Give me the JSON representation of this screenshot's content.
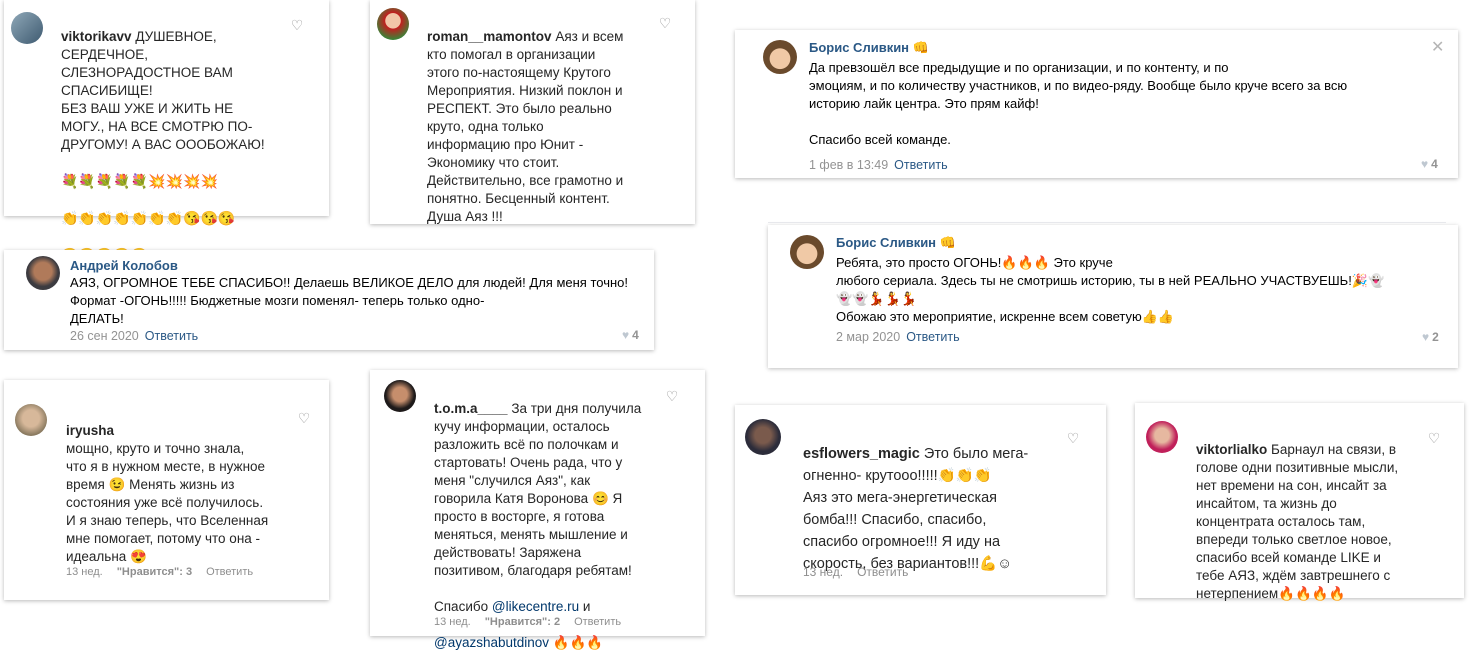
{
  "comments": {
    "c1": {
      "user": "viktorikavv",
      "text": "ДУШЕВНОЕ,\nСЕРДЕЧНОЕ,\nСЛЕЗНОРАДОСТНОЕ ВАМ\nСПАСИБИЩЕ!\nБЕЗ ВАШ УЖЕ И ЖИТЬ НЕ\nМОГУ., НА ВСЕ СМОТРЮ ПО-\nДРУГОМУ! А ВАС ОООБОЖАЮ!",
      "emoji1": "💐💐💐💐💐💥💥💥💥",
      "emoji2": "👏👏👏👏👏👏👏😘😘😘",
      "emoji3": "😘😘😘😘😘"
    },
    "c2": {
      "user": "roman__mamontov",
      "text_first": "Аяз и всем",
      "text": "кто помогал в организации\nэтого по-настоящему Крутого\nМероприятия. Низкий поклон и\nРЕСПЕКТ. Это было реально\nкруто, одна только\nинформацию про Юнит -\nЭкономику что стоит.\nДействительно, все грамотно и\nпонятно. Бесценный контент.\nДуша Аяз !!!"
    },
    "c3": {
      "user": "Борис Сливкин",
      "text": "Да  превзошёл все предыдущие и по организации, и по контенту, и по\nэмоциям, и по количеству участников, и по видео-ряду. Вообще было круче всего за всю\nисторию лайк центра. Это прям кайф!\n\nСпасибо всей команде.",
      "date": "1 фев в 13:49",
      "reply": "Ответить",
      "likes": "4",
      "close": "✕"
    },
    "c4": {
      "user": "Андрей Колобов",
      "text": "АЯЗ, ОГРОМНОЕ ТЕБЕ СПАСИБО!! Делаешь ВЕЛИКОЕ ДЕЛО для людей! Для меня точно!\nФормат -ОГОНЬ!!!!! Бюджетные мозги поменял- теперь только одно-\nДЕЛАТЬ!",
      "date": "26 сен 2020",
      "reply": "Ответить",
      "likes": "4"
    },
    "c5": {
      "user": "Борис Сливкин",
      "line1": "Ребята, это просто ОГОНЬ!🔥🔥🔥 Это круче",
      "line2": "любого сериала. Здесь ты не смотришь историю, ты в ней РЕАЛЬНО УЧАСТВУЕШЬ!🎉👻",
      "line3": "👻👻💃💃💃",
      "line4": "Обожаю это мероприятие, искренне всем советую👍👍",
      "date": "2 мар 2020",
      "reply": "Ответить",
      "likes": "2"
    },
    "c6": {
      "user": "iryusha",
      "text": "мощно, круто и точно знала,\nчто я в нужном месте, в нужное\nвремя 😉 Менять жизнь из\nсостояния уже всё получилось.\nИ я знаю теперь, что Вселенная\nмне помогает, потому что она -\nидеальна 😍",
      "time": "13 нед.",
      "likes": "\"Нравится\": 3",
      "reply": "Ответить"
    },
    "c7": {
      "user": "t.o.m.a____",
      "text_first": "За три дня получила",
      "text": "кучу информации, осталось\nразложить всё по полочкам и\nстартовать! Очень рада, что у\nменя \"случился Аяз\", как\nговорила Катя Воронова 😊 Я\nпросто в восторге, я готова\nменяться, менять мышление и\nдействовать! Заряжена\nпозитивом, благодаря ребятам!",
      "thanks": "Спасибо",
      "mention1": "@likecentre.ru",
      "and": "и",
      "mention2": "@ayazshabutdinov",
      "fire": "🔥🔥🔥",
      "time": "13 нед.",
      "likes": "\"Нравится\": 2",
      "reply": "Ответить"
    },
    "c8": {
      "user": "esflowers_magic",
      "text_first": "Это было мега-",
      "text": "огненно- крутооо!!!!!👏👏👏\nАяз это мега-энергетическая\nбомба!!! Спасибо, спасибо,\nспасибо огромное!!! Я иду на\nскорость, без вариантов!!!💪☺",
      "time": "13 нед.",
      "reply": "Ответить"
    },
    "c9": {
      "user": "viktorlialko",
      "text_first": "Барнаул на связи, в",
      "text": "голове одни позитивные мысли,\nнет времени на сон, инсайт за\nинсайтом, та жизнь до\nконцентрата осталось там,\nвпереди только светлое новое,\nспасибо всей команде LIKE и\nтебе АЯЗ, ждём завтрешнего с\nнетерпением🔥🔥🔥🔥"
    }
  },
  "fist": "👊"
}
